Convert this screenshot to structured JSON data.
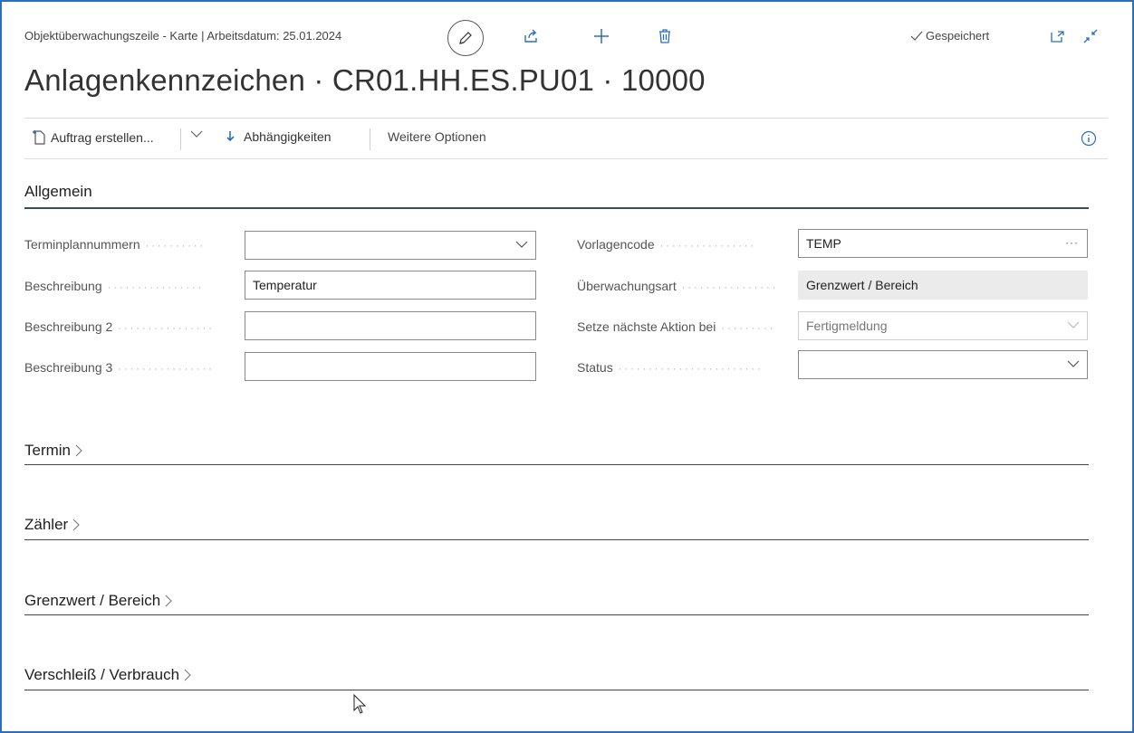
{
  "header": {
    "caption": "Objektüberwachungszeile - Karte | Arbeitsdatum: 25.01.2024",
    "saved_label": "Gespeichert",
    "title": "Anlagenkennzeichen · CR01.HH.ES.PU01 · 10000"
  },
  "actions": {
    "create_order": "Auftrag erstellen...",
    "dependencies": "Abhängigkeiten",
    "more_options": "Weitere Optionen"
  },
  "general": {
    "title": "Allgemein",
    "left_fields": [
      {
        "label": "Terminplannummern",
        "value": "",
        "type": "dropdown"
      },
      {
        "label": "Beschreibung",
        "value": "Temperatur",
        "type": "text"
      },
      {
        "label": "Beschreibung 2",
        "value": "",
        "type": "text"
      },
      {
        "label": "Beschreibung 3",
        "value": "",
        "type": "text"
      }
    ],
    "right_fields": [
      {
        "label": "Vorlagencode",
        "value": "TEMP",
        "type": "lookup"
      },
      {
        "label": "Überwachungsart",
        "value": "Grenzwert / Bereich",
        "type": "readonly"
      },
      {
        "label": "Setze nächste Aktion bei",
        "value": "Fertigmeldung",
        "type": "dropdown-disabled"
      },
      {
        "label": "Status",
        "value": "",
        "type": "dropdown"
      }
    ]
  },
  "sections": [
    "Termin",
    "Zähler",
    "Grenzwert / Bereich",
    "Verschleiß / Verbrauch"
  ],
  "colors": {
    "accent": "#2a6fba",
    "text": "#212121",
    "readonly_bg": "#ebebeb"
  }
}
